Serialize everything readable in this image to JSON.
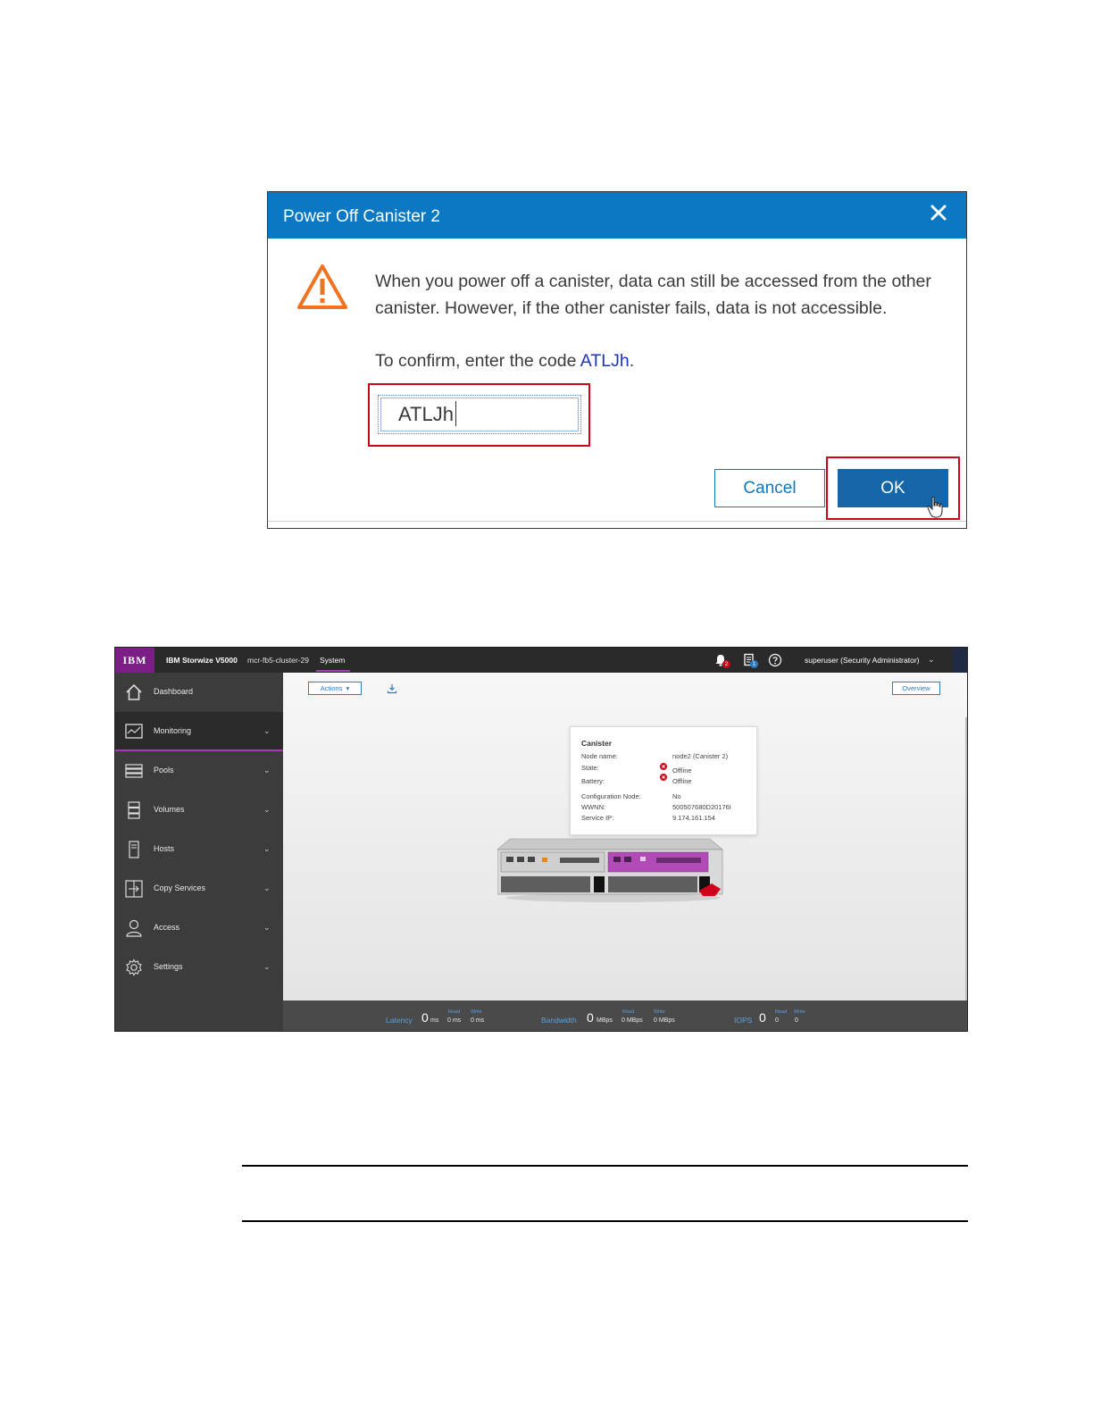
{
  "dialog": {
    "title": "Power Off Canister 2",
    "message": "When you power off a canister, data can still be accessed from the other canister. However, if the other canister fails, data is not accessible.",
    "confirm_prefix": "To confirm, enter the code ",
    "confirm_code": "ATLJh",
    "confirm_suffix": ".",
    "input_value": "ATLJh",
    "cancel_label": "Cancel",
    "ok_label": "OK"
  },
  "console": {
    "logo": "IBM",
    "product": "IBM Storwize V5000",
    "cluster": "mcr-fb5-cluster-29",
    "current_view": "System",
    "alerts_badge": "2",
    "tasks_badge": "1",
    "user": "superuser (Security Administrator)",
    "nav": [
      {
        "label": "Dashboard",
        "icon": "home-icon"
      },
      {
        "label": "Monitoring",
        "icon": "monitoring-icon"
      },
      {
        "label": "Pools",
        "icon": "pools-icon"
      },
      {
        "label": "Volumes",
        "icon": "volumes-icon"
      },
      {
        "label": "Hosts",
        "icon": "hosts-icon"
      },
      {
        "label": "Copy Services",
        "icon": "copy-services-icon"
      },
      {
        "label": "Access",
        "icon": "access-icon"
      },
      {
        "label": "Settings",
        "icon": "settings-icon"
      }
    ],
    "actions_label": "Actions",
    "overview_label": "Overview",
    "tooltip": {
      "title": "Canister",
      "rows": [
        {
          "k": "Node name:",
          "v": "node2 (Canister 2)"
        },
        {
          "k": "State:",
          "v": "Offline"
        },
        {
          "k": "Battery:",
          "v": "Offline"
        },
        {
          "k": "Configuration Node:",
          "v": "No"
        },
        {
          "k": "WWNN:",
          "v": "500507680D20176I"
        },
        {
          "k": "Service IP:",
          "v": "9.174.161.154"
        }
      ]
    },
    "status": {
      "latency_label": "Latency",
      "latency_value": "0",
      "latency_unit": "ms",
      "latency_read": "0 ms",
      "latency_write": "0 ms",
      "bandwidth_label": "Bandwidth",
      "bandwidth_value": "0",
      "bandwidth_unit": "MBps",
      "bandwidth_read": "0 MBps",
      "bandwidth_write": "0 MBps",
      "iops_label": "IOPS",
      "iops_value": "0",
      "iops_read": "0",
      "iops_write": "0",
      "read_label": "Read",
      "write_label": "Write"
    }
  }
}
